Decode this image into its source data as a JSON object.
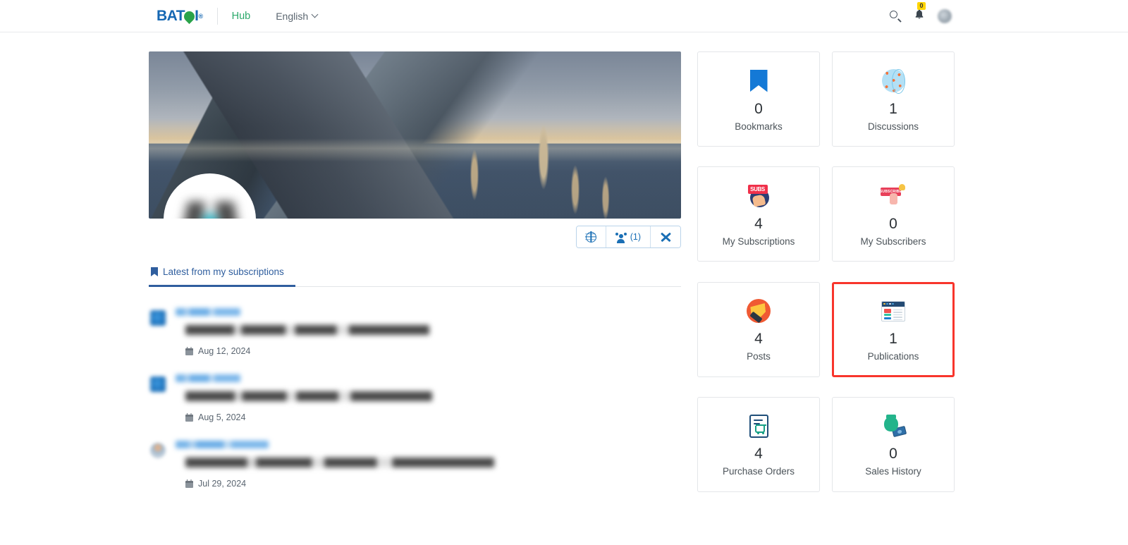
{
  "header": {
    "logo_text": "BAT",
    "logo_suffix": "I",
    "logo_reg": "®",
    "nav_hub": "Hub",
    "language": "English",
    "search_icon": "search-icon",
    "bell_icon": "bell-icon",
    "notification_count": "0",
    "avatar_icon": "user-avatar"
  },
  "profile": {
    "cover_alt": "lake-mountain-sunset-cover-photo",
    "avatar_alt": "profile-avatar-blurred",
    "name_redacted": "",
    "actions": [
      {
        "icon": "globe-icon",
        "label": ""
      },
      {
        "icon": "people-icon",
        "label": "(1)"
      },
      {
        "icon": "tools-icon",
        "label": ""
      }
    ]
  },
  "tabs": [
    {
      "label": "Latest from my subscriptions",
      "icon": "bookmark-icon",
      "active": true
    }
  ],
  "feed": [
    {
      "author": "",
      "title": "",
      "date": "Aug 12, 2024",
      "avatar_type": "square",
      "title_width": "w1",
      "author_width": ""
    },
    {
      "author": "",
      "title": "",
      "date": "Aug 5, 2024",
      "avatar_type": "square",
      "title_width": "w2",
      "author_width": ""
    },
    {
      "author": "",
      "title": "",
      "date": "Jul 29, 2024",
      "avatar_type": "round",
      "title_width": "w3",
      "author_width": "wide"
    }
  ],
  "stats": [
    {
      "value": "0",
      "label": "Bookmarks",
      "icon": "bookmark-icon",
      "highlighted": false
    },
    {
      "value": "1",
      "label": "Discussions",
      "icon": "globe-network-icon",
      "highlighted": false
    },
    {
      "value": "4",
      "label": "My Subscriptions",
      "icon": "subscriptions-icon",
      "highlighted": false
    },
    {
      "value": "0",
      "label": "My Subscribers",
      "icon": "subscribers-icon",
      "highlighted": false
    },
    {
      "value": "4",
      "label": "Posts",
      "icon": "pen-icon",
      "highlighted": false
    },
    {
      "value": "1",
      "label": "Publications",
      "icon": "publication-icon",
      "highlighted": true
    },
    {
      "value": "4",
      "label": "Purchase Orders",
      "icon": "purchase-order-icon",
      "highlighted": false
    },
    {
      "value": "0",
      "label": "Sales History",
      "icon": "sales-history-icon",
      "highlighted": false
    }
  ],
  "icon_labels": {
    "subs_tag": "SUBS",
    "subscribe_tag": "SUBSCRIBE"
  },
  "colors": {
    "brand_blue": "#1668b3",
    "brand_green": "#2aa34a",
    "hub_green": "#2aa86a",
    "accent_link": "#1a6fb5",
    "tab_active": "#2f5e9e",
    "highlight_red": "#f8352c",
    "badge_yellow": "#ffd500"
  }
}
